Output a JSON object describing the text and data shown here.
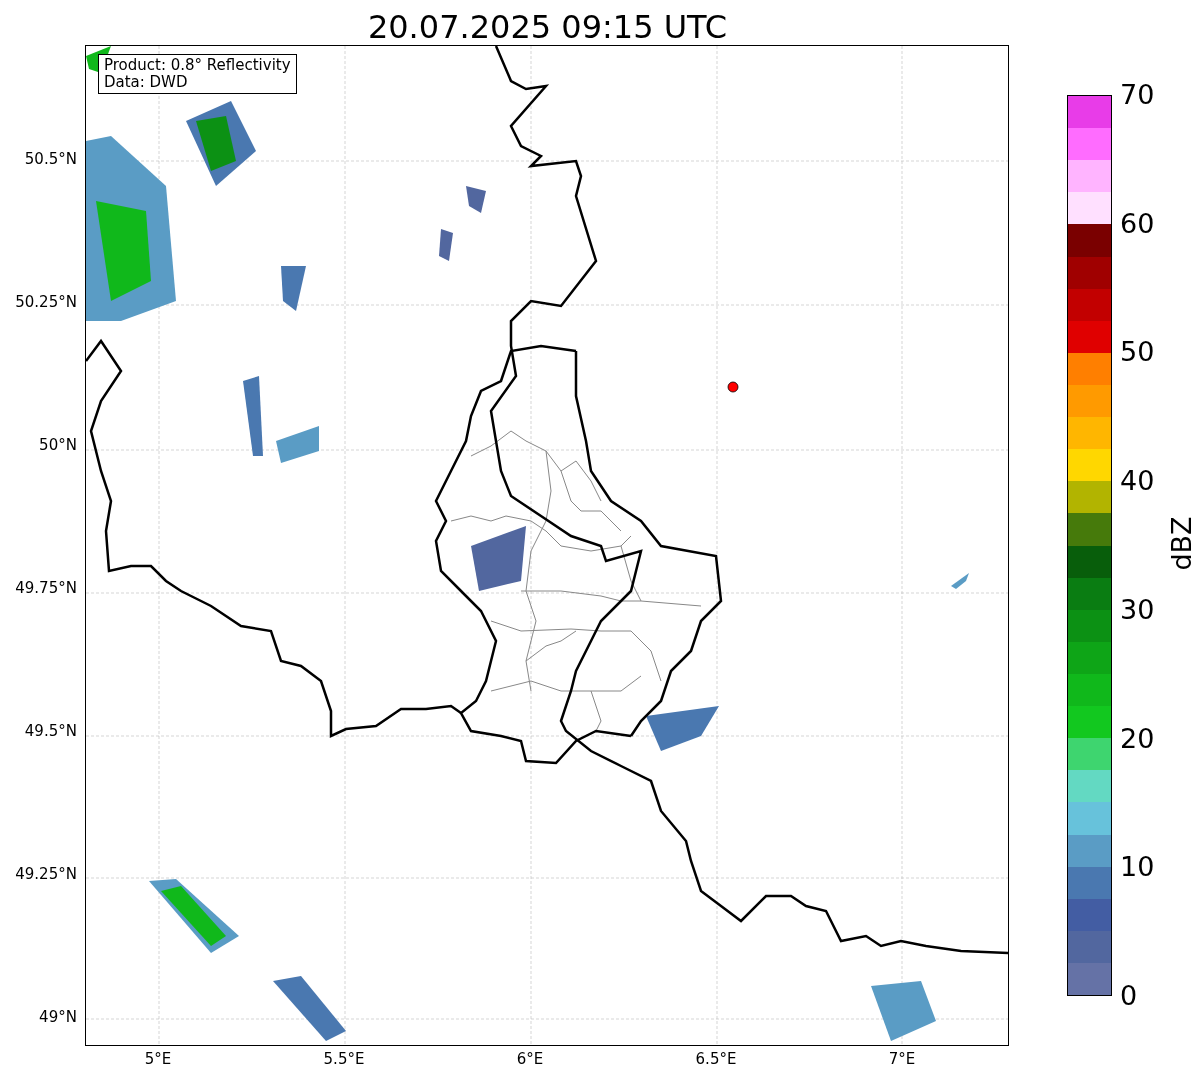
{
  "title": "20.07.2025 09:15 UTC",
  "map": {
    "info_box": [
      "Product: 0.8° Reflectivity",
      "Data: DWD"
    ],
    "y_ticks": [
      "50.5°N",
      "50.25°N",
      "50°N",
      "49.75°N",
      "49.5°N",
      "49.25°N",
      "49°N"
    ],
    "x_ticks": [
      "5°E",
      "5.5°E",
      "6°E",
      "6.5°E",
      "7°E"
    ]
  },
  "colorbar": {
    "label": "dBZ",
    "ticks": [
      "70",
      "60",
      "50",
      "40",
      "30",
      "20",
      "10",
      "0"
    ],
    "bins": [
      {
        "color": "#e83ce8"
      },
      {
        "color": "#ff6cff"
      },
      {
        "color": "#ffb4ff"
      },
      {
        "color": "#ffe0ff"
      },
      {
        "color": "#7a0000"
      },
      {
        "color": "#a00000"
      },
      {
        "color": "#c20000"
      },
      {
        "color": "#e00000"
      },
      {
        "color": "#ff7f00"
      },
      {
        "color": "#ff9a00"
      },
      {
        "color": "#ffb600"
      },
      {
        "color": "#ffd700"
      },
      {
        "color": "#b2b400"
      },
      {
        "color": "#467a0b"
      },
      {
        "color": "#085e0b"
      },
      {
        "color": "#0a7d12"
      },
      {
        "color": "#0c9114"
      },
      {
        "color": "#0ea517"
      },
      {
        "color": "#10b81b"
      },
      {
        "color": "#12c81f"
      },
      {
        "color": "#3ed56f"
      },
      {
        "color": "#63d9c2"
      },
      {
        "color": "#67c2db"
      },
      {
        "color": "#5a9cc5"
      },
      {
        "color": "#4a78b0"
      },
      {
        "color": "#435da3"
      },
      {
        "color": "#52679f"
      },
      {
        "color": "#6572a6"
      }
    ]
  }
}
